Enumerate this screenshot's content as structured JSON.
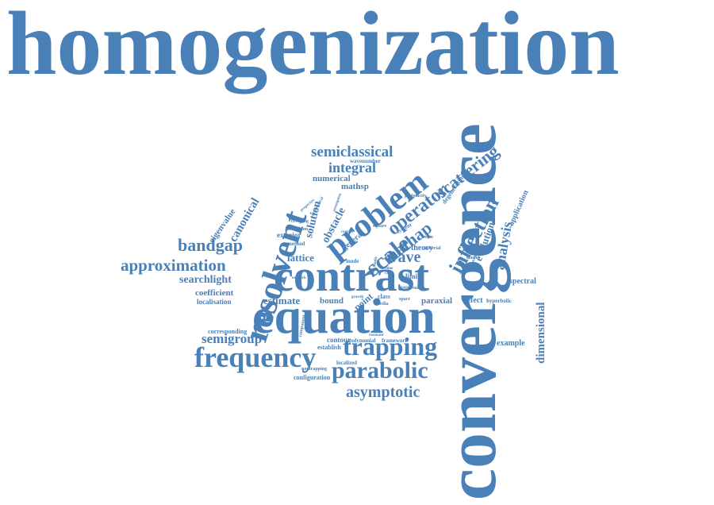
{
  "color": "#4a80b8",
  "words": {
    "homogenization": "homogenization",
    "convergence": "convergence",
    "equation": "equation",
    "contrast": "contrast",
    "resolvent": "resolvent",
    "problem": "problem",
    "frequency": "frequency",
    "trapping": "trapping",
    "parabolic": "parabolic",
    "scattering": "scattering",
    "semiclassical": "semiclassical",
    "approximation": "approximation",
    "integral": "integral",
    "scale": "scale",
    "operator": "operator",
    "inflection": "inflection",
    "bandgap": "bandgap",
    "asymptotic": "asymptotic",
    "wave": "wave",
    "mathap": "mathap",
    "analysis": "analysis",
    "dimensional": "dimensional",
    "semigroup": "semigroup",
    "searchlight": "searchlight",
    "canonical": "canonical",
    "estimate": "estimate",
    "lattice": "lattice",
    "solution": "solution",
    "evolution": "evolution",
    "obstacle": "obstacle",
    "numerical": "numerical",
    "mathsp": "mathsp",
    "eigenvalue": "eigenvalue",
    "coefficient": "coefficient",
    "localisation": "localisation",
    "bound": "bound",
    "point": "point",
    "paraxial": "paraxial",
    "defect": "defect",
    "spectral": "spectral",
    "application": "application",
    "example": "example",
    "theory": "theory",
    "general": "general",
    "exterior": "exterior",
    "corresponding": "corresponding",
    "contour": "contour",
    "establish": "establish",
    "localized": "localized",
    "configuration": "configuration",
    "nontrapping": "nontrapping",
    "hyperbolic": "hyperbolic",
    "wavenumber": "wavenumber",
    "system": "system",
    "limit": "limit",
    "class": "class",
    "method": "method",
    "mode": "mode",
    "polynomial": "polynomial",
    "framework": "framework",
    "degenerating": "degenerating",
    "periodicity": "periodicity",
    "elastic": "elastic",
    "material": "material",
    "beam": "beam",
    "component": "component",
    "creeping": "creeping",
    "transition": "transition",
    "result": "result",
    "space": "space",
    "media": "media",
    "square": "square",
    "certain": "certain",
    "family": "family",
    "network": "network",
    "growth": "growth",
    "stage": "stage",
    "case": "case",
    "value": "value",
    "existence": "existence",
    "prototypical": "prototypical",
    "properties": "properties",
    "assumption": "assumption",
    "resonant": "resonant"
  }
}
